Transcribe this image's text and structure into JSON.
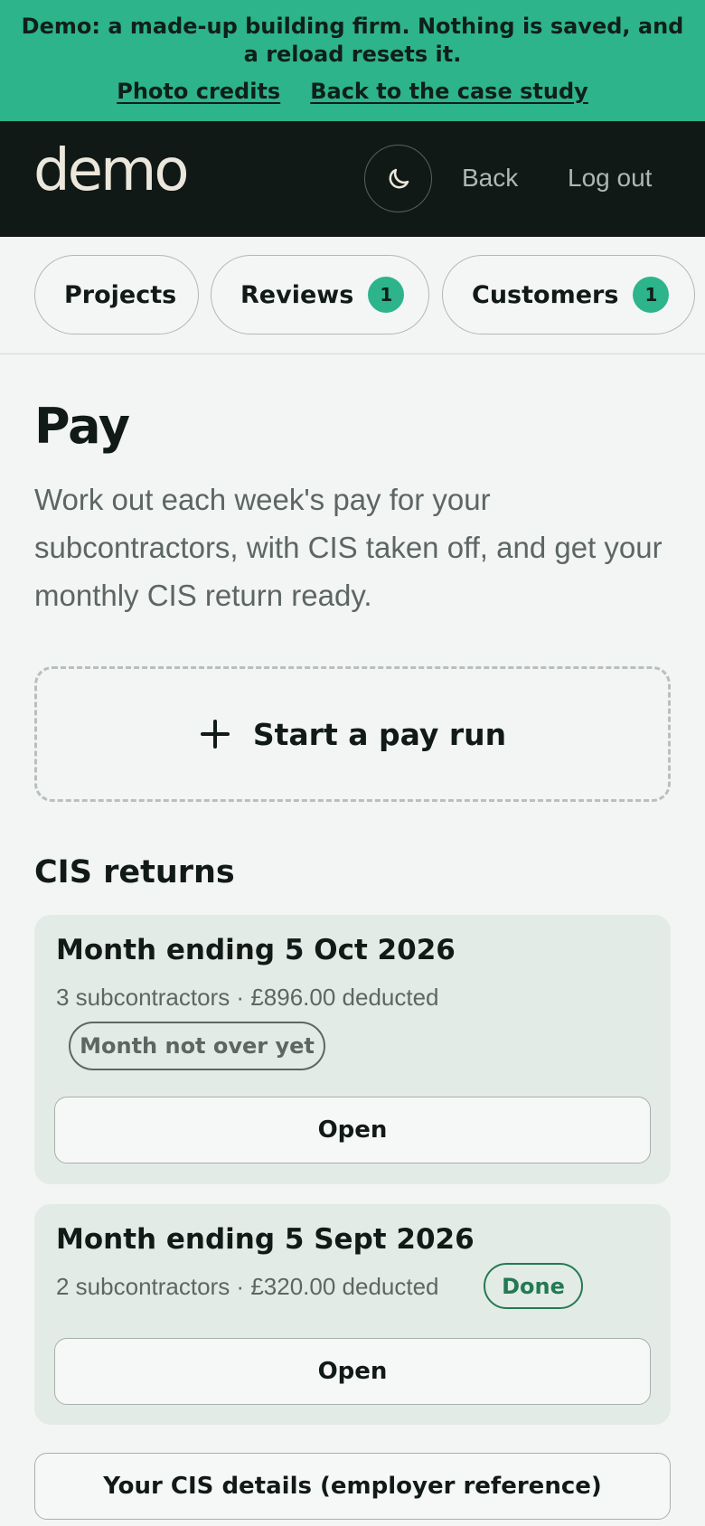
{
  "banner": {
    "text": "Demo: a made-up building firm. Nothing is saved, and a reload resets it.",
    "links": [
      "Photo credits",
      "Back to the case study"
    ]
  },
  "header": {
    "logo": "demo",
    "theme_icon": "moon-icon",
    "back_label": "Back",
    "logout_label": "Log out"
  },
  "tabs": [
    {
      "label": "Projects",
      "badge": null
    },
    {
      "label": "Reviews",
      "badge": "1"
    },
    {
      "label": "Customers",
      "badge": "1"
    }
  ],
  "main": {
    "title": "Pay",
    "description": "Work out each week's pay for your subcontractors, with CIS taken off, and get your monthly CIS return ready.",
    "start_button": "Start a pay run",
    "section_title": "CIS returns",
    "returns": [
      {
        "title": "Month ending 5 Oct 2026",
        "meta": "3 subcontractors · £896.00 deducted",
        "status": "Month not over yet",
        "open_label": "Open"
      },
      {
        "title": "Month ending 5 Sept 2026",
        "meta": "2 subcontractors · £320.00 deducted",
        "status": "Done",
        "open_label": "Open"
      }
    ],
    "details_button": "Your CIS details (employer reference)"
  },
  "colors": {
    "accent": "#2db48a",
    "topbar": "#101916",
    "done": "#237a52"
  }
}
